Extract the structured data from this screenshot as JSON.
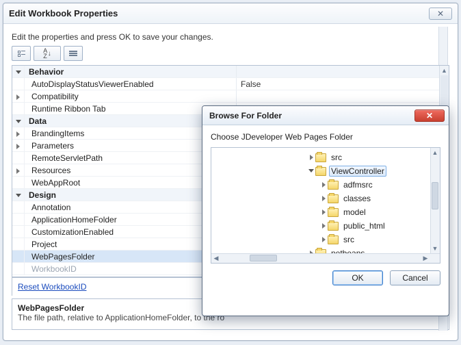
{
  "mainWindow": {
    "title": "Edit Workbook Properties",
    "instruction": "Edit the properties and press OK to save your changes."
  },
  "toolbar": {
    "categorized_tip": "Categorized",
    "sort_tip": "Alphabetical",
    "pages_tip": "Property Pages"
  },
  "grid": {
    "rows": [
      {
        "type": "cat",
        "expanded": true,
        "key": "Behavior",
        "val": ""
      },
      {
        "type": "child",
        "expanded": null,
        "key": "AutoDisplayStatusViewerEnabled",
        "val": "False"
      },
      {
        "type": "child",
        "expanded": false,
        "key": "Compatibility",
        "val": ""
      },
      {
        "type": "child",
        "expanded": null,
        "key": "Runtime Ribbon Tab",
        "val": ""
      },
      {
        "type": "cat",
        "expanded": true,
        "key": "Data",
        "val": ""
      },
      {
        "type": "child",
        "expanded": false,
        "key": "BrandingItems",
        "val": ""
      },
      {
        "type": "child",
        "expanded": false,
        "key": "Parameters",
        "val": ""
      },
      {
        "type": "child",
        "expanded": null,
        "key": "RemoteServletPath",
        "val": ""
      },
      {
        "type": "child",
        "expanded": false,
        "key": "Resources",
        "val": ""
      },
      {
        "type": "child",
        "expanded": null,
        "key": "WebAppRoot",
        "val": ""
      },
      {
        "type": "cat",
        "expanded": true,
        "key": "Design",
        "val": ""
      },
      {
        "type": "child",
        "expanded": null,
        "key": "Annotation",
        "val": ""
      },
      {
        "type": "child",
        "expanded": null,
        "key": "ApplicationHomeFolder",
        "val": ""
      },
      {
        "type": "child",
        "expanded": null,
        "key": "CustomizationEnabled",
        "val": ""
      },
      {
        "type": "child",
        "expanded": null,
        "key": "Project",
        "val": ""
      },
      {
        "type": "child",
        "expanded": null,
        "key": "WebPagesFolder",
        "val": "",
        "selected": true
      },
      {
        "type": "child",
        "expanded": null,
        "key": "WorkbookID",
        "val": "",
        "dim": true
      }
    ]
  },
  "resetLink": "Reset WorkbookID",
  "desc": {
    "title": "WebPagesFolder",
    "text": "The file path, relative to ApplicationHomeFolder, to the ro"
  },
  "dialog": {
    "title": "Browse For Folder",
    "instruction": "Choose JDeveloper Web Pages Folder",
    "ok": "OK",
    "cancel": "Cancel"
  },
  "tree": [
    {
      "depth": 0,
      "expanded": false,
      "label": "src"
    },
    {
      "depth": 0,
      "expanded": true,
      "label": "ViewController",
      "selected": true
    },
    {
      "depth": 1,
      "expanded": false,
      "label": "adfmsrc"
    },
    {
      "depth": 1,
      "expanded": false,
      "label": "classes"
    },
    {
      "depth": 1,
      "expanded": false,
      "label": "model"
    },
    {
      "depth": 1,
      "expanded": false,
      "label": "public_html"
    },
    {
      "depth": 1,
      "expanded": false,
      "label": "src"
    },
    {
      "depth": 0,
      "expanded": false,
      "label": "netbeans"
    }
  ]
}
